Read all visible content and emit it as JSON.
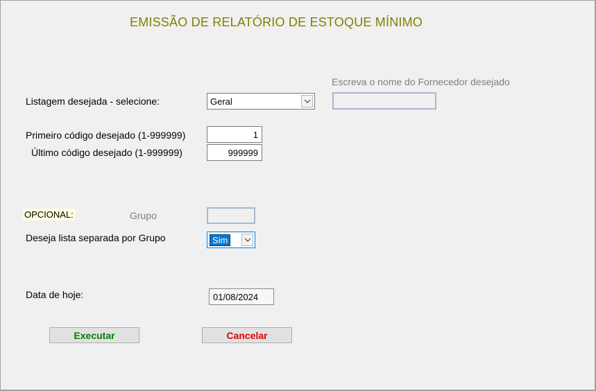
{
  "title": "EMISSÃO DE RELATÓRIO DE ESTOQUE MÍNIMO",
  "fornecedor": {
    "label": "Escreva o nome do Fornecedor desejado",
    "value": ""
  },
  "listagem": {
    "label": "Listagem desejada - selecione:",
    "selected": "Geral",
    "arrow_icon": "chevron-down-icon"
  },
  "codigo": {
    "primeiro_label": "Primeiro código desejado  (1-999999)",
    "primeiro_value": "1",
    "ultimo_label": "Último  código  desejado (1-999999)",
    "ultimo_value": "999999"
  },
  "opcional": {
    "label": "OPCIONAL:",
    "grupo_label": "Grupo",
    "grupo_value": ""
  },
  "separada": {
    "label": "Deseja lista separada por Grupo",
    "selected": "Sim"
  },
  "data": {
    "label": "Data de hoje:",
    "value": "01/08/2024"
  },
  "buttons": {
    "executar": "Executar",
    "cancelar": "Cancelar"
  },
  "colors": {
    "title": "#808000",
    "executar": "#008000",
    "cancelar": "#e00000",
    "selection": "#0078d7"
  }
}
